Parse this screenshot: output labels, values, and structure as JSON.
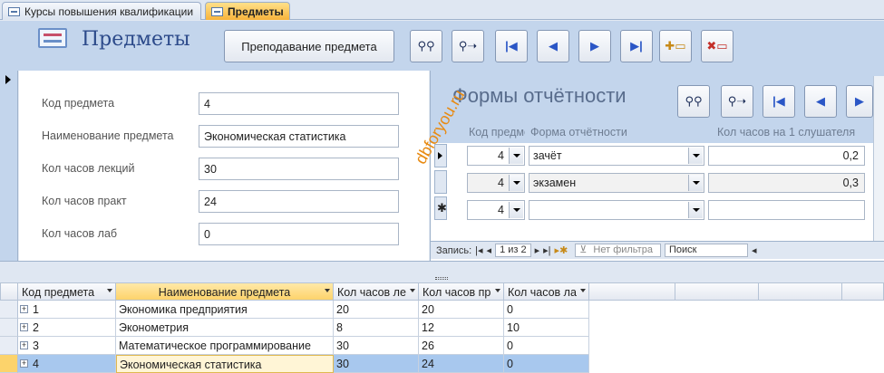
{
  "tabs": [
    {
      "label": "Курсы повышения квалификации"
    },
    {
      "label": "Предметы"
    }
  ],
  "header": {
    "title": "Предметы",
    "teach_button": "Преподавание предмета"
  },
  "form": {
    "fields": [
      {
        "label": "Код предмета",
        "value": "4"
      },
      {
        "label": "Наименование предмета",
        "value": "Экономическая статистика"
      },
      {
        "label": "Кол часов лекций",
        "value": "30"
      },
      {
        "label": "Кол часов практ",
        "value": "24"
      },
      {
        "label": "Кол часов лаб",
        "value": "0"
      }
    ]
  },
  "subform": {
    "title": "Формы отчётности",
    "columns": [
      "Код предмета",
      "Форма отчётности",
      "Кол часов на 1 слушателя"
    ],
    "rows": [
      {
        "code": "4",
        "form": "зачёт",
        "hours": "0,2"
      },
      {
        "code": "4",
        "form": "экзамен",
        "hours": "0,3"
      },
      {
        "code": "4",
        "form": "",
        "hours": ""
      }
    ],
    "record_label": "Запись:",
    "record_pos": "1 из 2",
    "filter": "Нет фильтра",
    "search": "Поиск"
  },
  "watermark": "dbforyou.ru",
  "datasheet": {
    "columns": [
      "Код предмета",
      "Наименование предмета",
      "Кол часов лекций",
      "Кол часов практ",
      "Кол часов лаб"
    ],
    "rows": [
      [
        "1",
        "Экономика предприятия",
        "20",
        "20",
        "0"
      ],
      [
        "2",
        "Эконометрия",
        "8",
        "12",
        "10"
      ],
      [
        "3",
        "Математическое программирование",
        "30",
        "26",
        "0"
      ],
      [
        "4",
        "Экономическая статистика",
        "30",
        "24",
        "0"
      ]
    ]
  }
}
